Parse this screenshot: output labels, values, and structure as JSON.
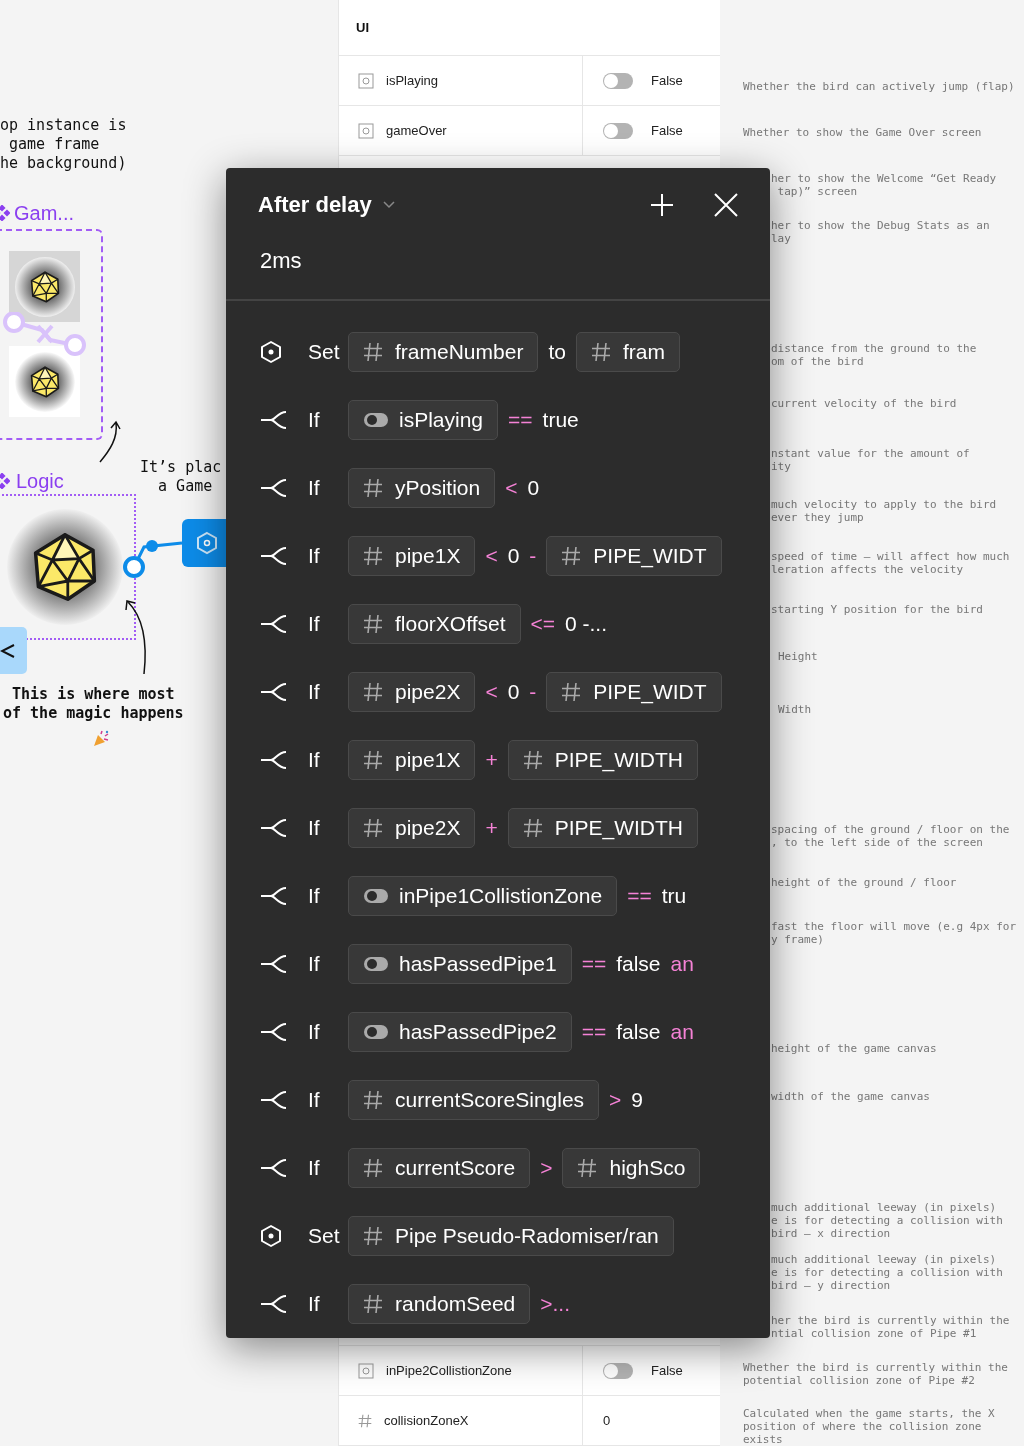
{
  "canvas": {
    "notes": [
      {
        "kind": "plain",
        "text": "op instance is\n game frame\nhe background)"
      },
      {
        "kind": "plain",
        "text": "It’s plac\n  a Game"
      },
      {
        "kind": "bold",
        "text": "This is where most\nof the magic happens"
      }
    ],
    "frames": [
      {
        "label": "Gam..."
      },
      {
        "label": "Logic"
      }
    ]
  },
  "variables_table": {
    "group": "UI",
    "top_rows": [
      {
        "kind": "boolean",
        "name": "isPlaying",
        "on": false,
        "value": "False"
      },
      {
        "kind": "boolean",
        "name": "gameOver",
        "on": false,
        "value": "False"
      }
    ],
    "bottom_rows": [
      {
        "kind": "boolean",
        "name": "inPipe2CollistionZone",
        "on": false,
        "value": "False"
      },
      {
        "kind": "number",
        "name": "collisionZoneX",
        "value": "0"
      }
    ]
  },
  "descriptions": [
    "Whether the bird can actively jump (flap)",
    "Whether to show the Game Over screen",
    "her to show the Welcome “Get Ready\n tap)” screen",
    "her to show the Debug Stats as an\nlay",
    "distance from the ground to the\nom of the bird",
    "current velocity of the bird",
    "nstant value for the amount of\nity",
    "much velocity to apply to the bird\never they jump",
    "speed of time – will affect how much\nleration affects the velocity",
    "starting Y position for the bird",
    "Height",
    "Width",
    "spacing of the ground / floor on the\n, to the left side of the screen",
    "height of the ground / floor",
    "fast the floor will move (e.g 4px for\ny frame)",
    "height of the game canvas",
    "width of the game canvas",
    "much additional leeway (in pixels)\ne is for detecting a collision with\nbird – x direction",
    "much additional leeway (in pixels)\ne is for detecting a collision with\nbird – y direction",
    "her the bird is currently within the\nntial collision zone of Pipe #1",
    "Whether the bird is currently within the\npotential collision zone of Pipe #2",
    "Calculated when the game starts, the X\nposition of where the collision zone\nexists"
  ],
  "popover": {
    "title": "After delay",
    "delay": "2ms",
    "actions": [
      {
        "kind": "set",
        "keyword": "Set",
        "tokens": [
          {
            "kind": "number_var",
            "text": "frameNumber"
          },
          {
            "kind": "text",
            "text": "to"
          },
          {
            "kind": "number_var",
            "text": "fram"
          }
        ]
      },
      {
        "kind": "if",
        "keyword": "If",
        "tokens": [
          {
            "kind": "bool_var",
            "text": "isPlaying"
          },
          {
            "kind": "op",
            "text": "=="
          },
          {
            "kind": "text",
            "text": "true"
          }
        ]
      },
      {
        "kind": "if",
        "keyword": "If",
        "tokens": [
          {
            "kind": "number_var",
            "text": "yPosition"
          },
          {
            "kind": "op",
            "text": "<"
          },
          {
            "kind": "text",
            "text": "0"
          }
        ]
      },
      {
        "kind": "if",
        "keyword": "If",
        "tokens": [
          {
            "kind": "number_var",
            "text": "pipe1X"
          },
          {
            "kind": "op",
            "text": "<"
          },
          {
            "kind": "text",
            "text": "0"
          },
          {
            "kind": "op",
            "text": "-"
          },
          {
            "kind": "number_var",
            "text": "PIPE_WIDT"
          }
        ]
      },
      {
        "kind": "if",
        "keyword": "If",
        "tokens": [
          {
            "kind": "number_var",
            "text": "floorXOffset"
          },
          {
            "kind": "op",
            "text": "<="
          },
          {
            "kind": "text",
            "text": "0 -..."
          }
        ]
      },
      {
        "kind": "if",
        "keyword": "If",
        "tokens": [
          {
            "kind": "number_var",
            "text": "pipe2X"
          },
          {
            "kind": "op",
            "text": "<"
          },
          {
            "kind": "text",
            "text": "0"
          },
          {
            "kind": "op",
            "text": "-"
          },
          {
            "kind": "number_var",
            "text": "PIPE_WIDT"
          }
        ]
      },
      {
        "kind": "if",
        "keyword": "If",
        "tokens": [
          {
            "kind": "number_var",
            "text": "pipe1X"
          },
          {
            "kind": "op",
            "text": "+"
          },
          {
            "kind": "number_var",
            "text": "PIPE_WIDTH"
          }
        ]
      },
      {
        "kind": "if",
        "keyword": "If",
        "tokens": [
          {
            "kind": "number_var",
            "text": "pipe2X"
          },
          {
            "kind": "op",
            "text": "+"
          },
          {
            "kind": "number_var",
            "text": "PIPE_WIDTH"
          }
        ]
      },
      {
        "kind": "if",
        "keyword": "If",
        "tokens": [
          {
            "kind": "bool_var",
            "text": "inPipe1CollistionZone"
          },
          {
            "kind": "op",
            "text": "=="
          },
          {
            "kind": "text",
            "text": "tru"
          }
        ]
      },
      {
        "kind": "if",
        "keyword": "If",
        "tokens": [
          {
            "kind": "bool_var",
            "text": "hasPassedPipe1"
          },
          {
            "kind": "op",
            "text": "=="
          },
          {
            "kind": "text",
            "text": "false"
          },
          {
            "kind": "op",
            "text": "an"
          }
        ]
      },
      {
        "kind": "if",
        "keyword": "If",
        "tokens": [
          {
            "kind": "bool_var",
            "text": "hasPassedPipe2"
          },
          {
            "kind": "op",
            "text": "=="
          },
          {
            "kind": "text",
            "text": "false"
          },
          {
            "kind": "op",
            "text": "an"
          }
        ]
      },
      {
        "kind": "if",
        "keyword": "If",
        "tokens": [
          {
            "kind": "number_var",
            "text": "currentScoreSingles"
          },
          {
            "kind": "op",
            "text": ">"
          },
          {
            "kind": "text",
            "text": "9"
          }
        ]
      },
      {
        "kind": "if",
        "keyword": "If",
        "tokens": [
          {
            "kind": "number_var",
            "text": "currentScore"
          },
          {
            "kind": "op",
            "text": ">"
          },
          {
            "kind": "number_var",
            "text": "highSco"
          }
        ]
      },
      {
        "kind": "set",
        "keyword": "Set",
        "tokens": [
          {
            "kind": "number_var",
            "text": "Pipe Pseudo-Radomiser/ran"
          }
        ]
      },
      {
        "kind": "if",
        "keyword": "If",
        "tokens": [
          {
            "kind": "number_var",
            "text": "randomSeed"
          },
          {
            "kind": "op",
            "text": ">..."
          }
        ]
      }
    ]
  }
}
